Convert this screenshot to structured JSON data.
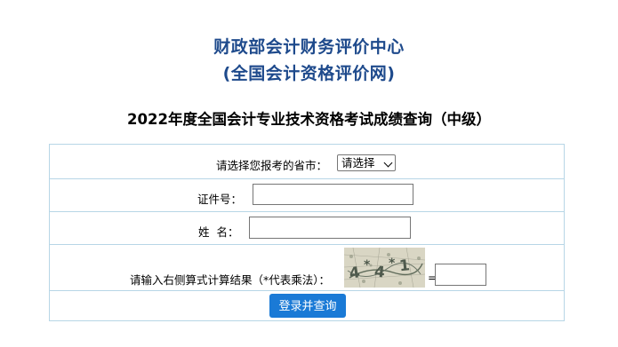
{
  "header": {
    "title_line1": "财政部会计财务评价中心",
    "title_line2": "(全国会计资格评价网)"
  },
  "page_heading": "2022年度全国会计专业技术资格考试成绩查询（中级）",
  "form": {
    "province_label": "请选择您报考的省市：",
    "province_selected": "请选择",
    "id_label": "证件号：",
    "id_value": "",
    "name_label": "姓  名：",
    "name_value": "",
    "captcha_label": "请输入右侧算式计算结果（*代表乘法）：",
    "captcha_equals": "=",
    "captcha_value": "",
    "submit_label": "登录并查询"
  },
  "colors": {
    "title_blue": "#1e4a8c",
    "border": "#b7d6e6",
    "button_blue": "#1a7ad6"
  }
}
